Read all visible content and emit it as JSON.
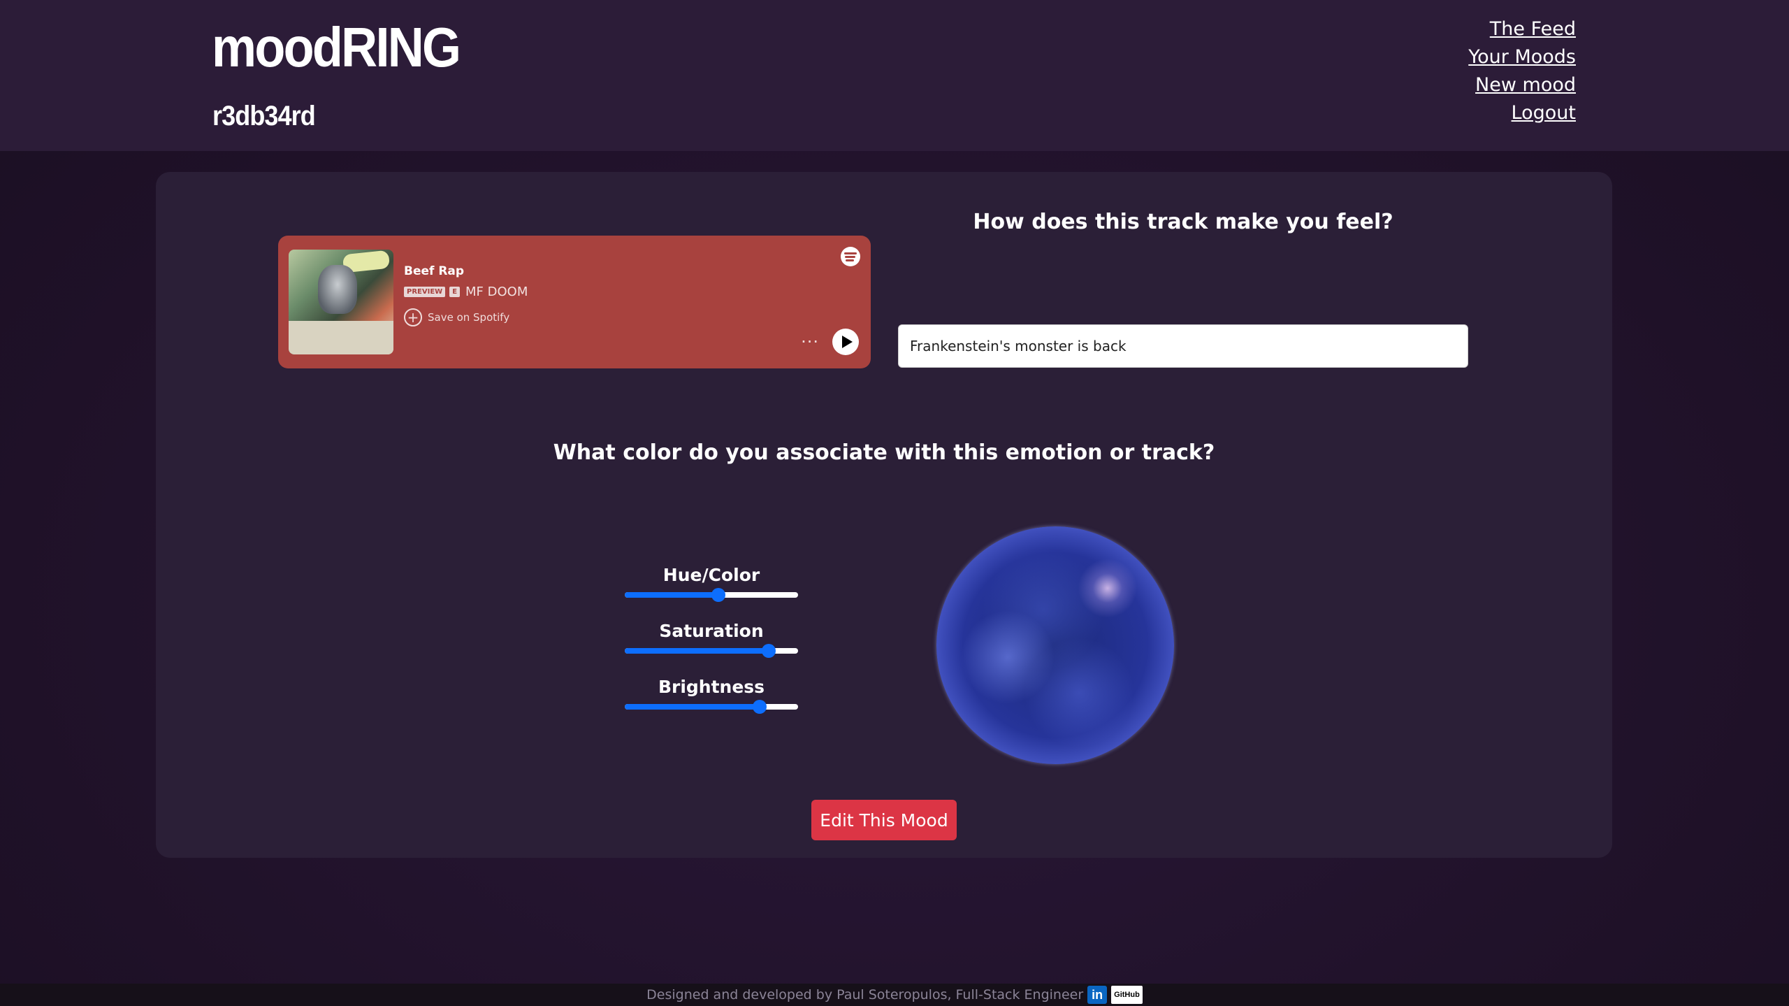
{
  "header": {
    "logo": "moodRING",
    "username": "r3db34rd",
    "nav": [
      "The Feed",
      "Your Moods",
      "New mood",
      "Logout"
    ]
  },
  "embed": {
    "track_title": "Beef Rap",
    "preview_badge": "PREVIEW",
    "explicit_badge": "E",
    "artist": "MF DOOM",
    "save_label": "Save on Spotify",
    "more_label": "···"
  },
  "form": {
    "feel_question": "How does this track make you feel?",
    "feel_value": "Frankenstein's monster is back",
    "color_question": "What color do you associate with this emotion or track?",
    "sliders": [
      {
        "label": "Hue/Color",
        "value": 0.54
      },
      {
        "label": "Saturation",
        "value": 0.83
      },
      {
        "label": "Brightness",
        "value": 0.78
      }
    ],
    "submit_label": "Edit This Mood"
  },
  "colors": {
    "accent": "#0d6efd",
    "embed_bg": "#a8423e",
    "button": "#dc3545",
    "orb": "#3a4ad0"
  },
  "footer": {
    "text": "Designed and developed by Paul Soteropulos, Full-Stack Engineer",
    "linkedin_label": "in",
    "github_label": "GitHub"
  }
}
